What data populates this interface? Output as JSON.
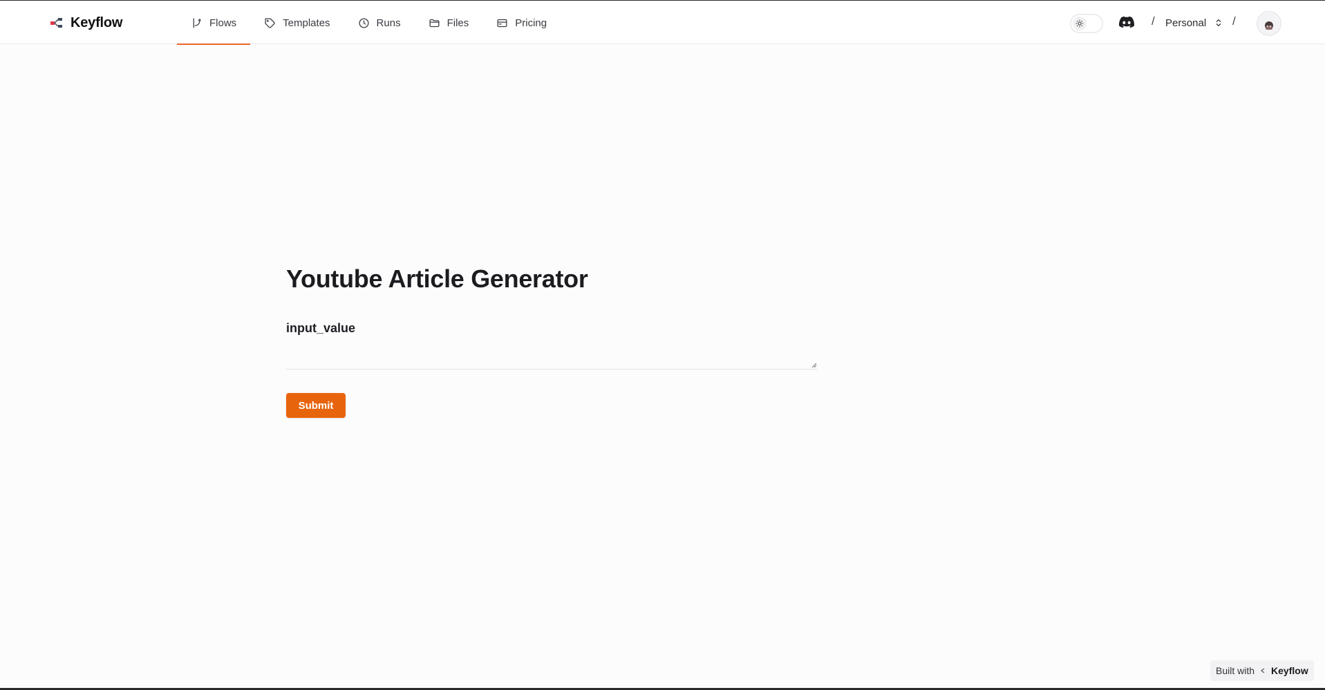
{
  "header": {
    "brand": "Keyflow",
    "nav": [
      {
        "label": "Flows",
        "icon": "git-branch-icon",
        "active": true
      },
      {
        "label": "Templates",
        "icon": "tag-icon",
        "active": false
      },
      {
        "label": "Runs",
        "icon": "clock-icon",
        "active": false
      },
      {
        "label": "Files",
        "icon": "folder-icon",
        "active": false
      },
      {
        "label": "Pricing",
        "icon": "credit-card-icon",
        "active": false
      }
    ],
    "workspace": "Personal",
    "separator": "/"
  },
  "main": {
    "title": "Youtube Article Generator",
    "field_label": "input_value",
    "field_value": "",
    "submit_label": "Submit"
  },
  "footer": {
    "built_with": "Built with",
    "brand": "Keyflow"
  },
  "colors": {
    "accent": "#e8640c",
    "active_tab_underline": "#e8642a",
    "background": "#fcfcfd"
  }
}
